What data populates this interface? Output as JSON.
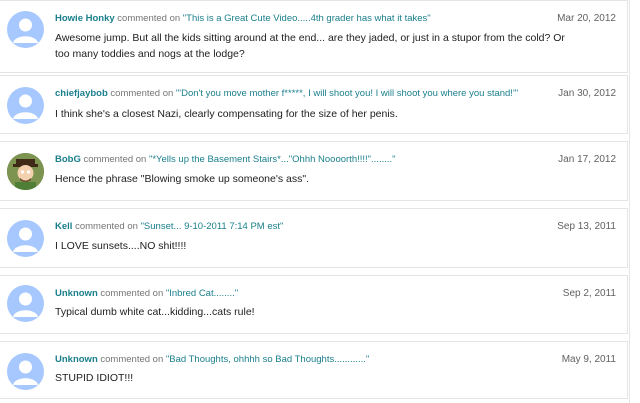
{
  "comments": [
    {
      "author": "Howie Honky",
      "action": " commented on ",
      "post": "\"This is a Great Cute Video.....4th grader has what it takes\"",
      "date": "Mar 20, 2012",
      "text": "Awesome jump. But all the kids sitting around at the end... are they jaded, or just in a stupor from the cold? Or too many toddies and nogs at the lodge?",
      "avatar": "default-avatar-icon"
    },
    {
      "author": "chiefjaybob",
      "action": " commented on ",
      "post": "\"'Don't you move mother f*****, I will shoot you! I will shoot you where you stand!'\"",
      "date": "Jan 30, 2012",
      "text": "I think she's a closest Nazi, clearly compensating for the size of her penis.",
      "avatar": "default-avatar-icon"
    },
    {
      "author": "BobG",
      "action": " commented on ",
      "post": "\"*Yells up the Basement Stairs*...\"Ohhh Noooorth!!!!\"........\"",
      "date": "Jan 17, 2012",
      "text": "Hence the phrase \"Blowing smoke up someone's ass\".",
      "avatar": "cartoon-avatar-icon"
    },
    {
      "author": "Kell",
      "action": " commented on ",
      "post": "\"Sunset... 9-10-2011 7:14 PM est\"",
      "date": "Sep 13, 2011",
      "text": "I LOVE sunsets....NO shit!!!!",
      "avatar": "default-avatar-icon"
    },
    {
      "author": "Unknown",
      "action": " commented on ",
      "post": "\"Inbred Cat........\"",
      "date": "Sep 2, 2011",
      "text": "Typical dumb white cat...kidding...cats rule!",
      "avatar": "default-avatar-icon"
    },
    {
      "author": "Unknown",
      "action": " commented on ",
      "post": "\"Bad Thoughts, ohhhh so Bad Thoughts............\"",
      "date": "May 9, 2011",
      "text": "STUPID IDIOT!!!",
      "avatar": "default-avatar-icon"
    }
  ],
  "colors": {
    "link": "#1a7f8c",
    "avatar_bg": "#a6c8ff",
    "avatar_fg": "#ffffff"
  }
}
